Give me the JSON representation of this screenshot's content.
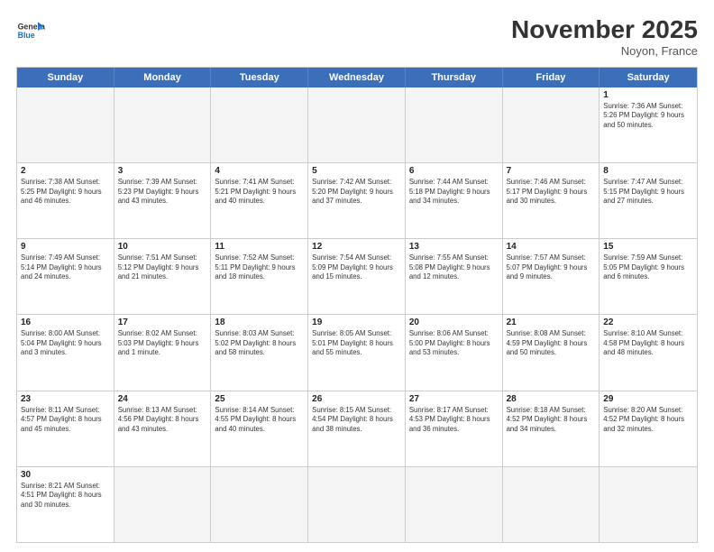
{
  "header": {
    "logo_general": "General",
    "logo_blue": "Blue",
    "month_title": "November 2025",
    "location": "Noyon, France"
  },
  "days_of_week": [
    "Sunday",
    "Monday",
    "Tuesday",
    "Wednesday",
    "Thursday",
    "Friday",
    "Saturday"
  ],
  "weeks": [
    [
      {
        "day": "",
        "info": "",
        "empty": true
      },
      {
        "day": "",
        "info": "",
        "empty": true
      },
      {
        "day": "",
        "info": "",
        "empty": true
      },
      {
        "day": "",
        "info": "",
        "empty": true
      },
      {
        "day": "",
        "info": "",
        "empty": true
      },
      {
        "day": "",
        "info": "",
        "empty": true
      },
      {
        "day": "1",
        "info": "Sunrise: 7:36 AM\nSunset: 5:26 PM\nDaylight: 9 hours\nand 50 minutes."
      }
    ],
    [
      {
        "day": "2",
        "info": "Sunrise: 7:38 AM\nSunset: 5:25 PM\nDaylight: 9 hours\nand 46 minutes."
      },
      {
        "day": "3",
        "info": "Sunrise: 7:39 AM\nSunset: 5:23 PM\nDaylight: 9 hours\nand 43 minutes."
      },
      {
        "day": "4",
        "info": "Sunrise: 7:41 AM\nSunset: 5:21 PM\nDaylight: 9 hours\nand 40 minutes."
      },
      {
        "day": "5",
        "info": "Sunrise: 7:42 AM\nSunset: 5:20 PM\nDaylight: 9 hours\nand 37 minutes."
      },
      {
        "day": "6",
        "info": "Sunrise: 7:44 AM\nSunset: 5:18 PM\nDaylight: 9 hours\nand 34 minutes."
      },
      {
        "day": "7",
        "info": "Sunrise: 7:46 AM\nSunset: 5:17 PM\nDaylight: 9 hours\nand 30 minutes."
      },
      {
        "day": "8",
        "info": "Sunrise: 7:47 AM\nSunset: 5:15 PM\nDaylight: 9 hours\nand 27 minutes."
      }
    ],
    [
      {
        "day": "9",
        "info": "Sunrise: 7:49 AM\nSunset: 5:14 PM\nDaylight: 9 hours\nand 24 minutes."
      },
      {
        "day": "10",
        "info": "Sunrise: 7:51 AM\nSunset: 5:12 PM\nDaylight: 9 hours\nand 21 minutes."
      },
      {
        "day": "11",
        "info": "Sunrise: 7:52 AM\nSunset: 5:11 PM\nDaylight: 9 hours\nand 18 minutes."
      },
      {
        "day": "12",
        "info": "Sunrise: 7:54 AM\nSunset: 5:09 PM\nDaylight: 9 hours\nand 15 minutes."
      },
      {
        "day": "13",
        "info": "Sunrise: 7:55 AM\nSunset: 5:08 PM\nDaylight: 9 hours\nand 12 minutes."
      },
      {
        "day": "14",
        "info": "Sunrise: 7:57 AM\nSunset: 5:07 PM\nDaylight: 9 hours\nand 9 minutes."
      },
      {
        "day": "15",
        "info": "Sunrise: 7:59 AM\nSunset: 5:05 PM\nDaylight: 9 hours\nand 6 minutes."
      }
    ],
    [
      {
        "day": "16",
        "info": "Sunrise: 8:00 AM\nSunset: 5:04 PM\nDaylight: 9 hours\nand 3 minutes."
      },
      {
        "day": "17",
        "info": "Sunrise: 8:02 AM\nSunset: 5:03 PM\nDaylight: 9 hours\nand 1 minute."
      },
      {
        "day": "18",
        "info": "Sunrise: 8:03 AM\nSunset: 5:02 PM\nDaylight: 8 hours\nand 58 minutes."
      },
      {
        "day": "19",
        "info": "Sunrise: 8:05 AM\nSunset: 5:01 PM\nDaylight: 8 hours\nand 55 minutes."
      },
      {
        "day": "20",
        "info": "Sunrise: 8:06 AM\nSunset: 5:00 PM\nDaylight: 8 hours\nand 53 minutes."
      },
      {
        "day": "21",
        "info": "Sunrise: 8:08 AM\nSunset: 4:59 PM\nDaylight: 8 hours\nand 50 minutes."
      },
      {
        "day": "22",
        "info": "Sunrise: 8:10 AM\nSunset: 4:58 PM\nDaylight: 8 hours\nand 48 minutes."
      }
    ],
    [
      {
        "day": "23",
        "info": "Sunrise: 8:11 AM\nSunset: 4:57 PM\nDaylight: 8 hours\nand 45 minutes."
      },
      {
        "day": "24",
        "info": "Sunrise: 8:13 AM\nSunset: 4:56 PM\nDaylight: 8 hours\nand 43 minutes."
      },
      {
        "day": "25",
        "info": "Sunrise: 8:14 AM\nSunset: 4:55 PM\nDaylight: 8 hours\nand 40 minutes."
      },
      {
        "day": "26",
        "info": "Sunrise: 8:15 AM\nSunset: 4:54 PM\nDaylight: 8 hours\nand 38 minutes."
      },
      {
        "day": "27",
        "info": "Sunrise: 8:17 AM\nSunset: 4:53 PM\nDaylight: 8 hours\nand 36 minutes."
      },
      {
        "day": "28",
        "info": "Sunrise: 8:18 AM\nSunset: 4:52 PM\nDaylight: 8 hours\nand 34 minutes."
      },
      {
        "day": "29",
        "info": "Sunrise: 8:20 AM\nSunset: 4:52 PM\nDaylight: 8 hours\nand 32 minutes."
      }
    ],
    [
      {
        "day": "30",
        "info": "Sunrise: 8:21 AM\nSunset: 4:51 PM\nDaylight: 8 hours\nand 30 minutes."
      },
      {
        "day": "",
        "info": "",
        "empty": true
      },
      {
        "day": "",
        "info": "",
        "empty": true
      },
      {
        "day": "",
        "info": "",
        "empty": true
      },
      {
        "day": "",
        "info": "",
        "empty": true
      },
      {
        "day": "",
        "info": "",
        "empty": true
      },
      {
        "day": "",
        "info": "",
        "empty": true
      }
    ]
  ]
}
